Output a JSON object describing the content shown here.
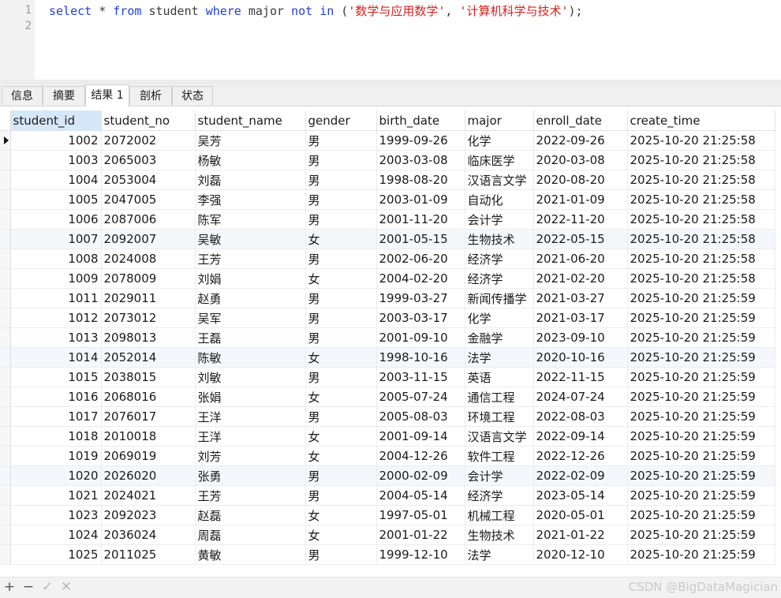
{
  "editor": {
    "line_numbers": [
      "1",
      "2"
    ],
    "sql": {
      "select": "select",
      "star": "*",
      "from": "from",
      "table": "student",
      "where": "where",
      "column": "major",
      "not": "not",
      "in": "in",
      "open": "(",
      "value1": "'数学与应用数学'",
      "comma": ",",
      "value2": "'计算机科学与技术'",
      "close": ");"
    }
  },
  "tabs": [
    {
      "label": "信息",
      "active": false
    },
    {
      "label": "摘要",
      "active": false
    },
    {
      "label": "结果 1",
      "active": true
    },
    {
      "label": "剖析",
      "active": false
    },
    {
      "label": "状态",
      "active": false
    }
  ],
  "grid": {
    "columns": [
      "student_id",
      "student_no",
      "student_name",
      "gender",
      "birth_date",
      "major",
      "enroll_date",
      "create_time"
    ],
    "rows": [
      [
        "1002",
        "2072002",
        "吴芳",
        "男",
        "1999-09-26",
        "化学",
        "2022-09-26",
        "2025-10-20 21:25:58"
      ],
      [
        "1003",
        "2065003",
        "杨敏",
        "男",
        "2003-03-08",
        "临床医学",
        "2020-03-08",
        "2025-10-20 21:25:58"
      ],
      [
        "1004",
        "2053004",
        "刘磊",
        "男",
        "1998-08-20",
        "汉语言文学",
        "2020-08-20",
        "2025-10-20 21:25:58"
      ],
      [
        "1005",
        "2047005",
        "李强",
        "男",
        "2003-01-09",
        "自动化",
        "2021-01-09",
        "2025-10-20 21:25:58"
      ],
      [
        "1006",
        "2087006",
        "陈军",
        "男",
        "2001-11-20",
        "会计学",
        "2022-11-20",
        "2025-10-20 21:25:58"
      ],
      [
        "1007",
        "2092007",
        "吴敏",
        "女",
        "2001-05-15",
        "生物技术",
        "2022-05-15",
        "2025-10-20 21:25:58"
      ],
      [
        "1008",
        "2024008",
        "王芳",
        "男",
        "2002-06-20",
        "经济学",
        "2021-06-20",
        "2025-10-20 21:25:58"
      ],
      [
        "1009",
        "2078009",
        "刘娟",
        "女",
        "2004-02-20",
        "经济学",
        "2021-02-20",
        "2025-10-20 21:25:58"
      ],
      [
        "1011",
        "2029011",
        "赵勇",
        "男",
        "1999-03-27",
        "新闻传播学",
        "2021-03-27",
        "2025-10-20 21:25:59"
      ],
      [
        "1012",
        "2073012",
        "吴军",
        "男",
        "2003-03-17",
        "化学",
        "2021-03-17",
        "2025-10-20 21:25:59"
      ],
      [
        "1013",
        "2098013",
        "王磊",
        "男",
        "2001-09-10",
        "金融学",
        "2023-09-10",
        "2025-10-20 21:25:59"
      ],
      [
        "1014",
        "2052014",
        "陈敏",
        "女",
        "1998-10-16",
        "法学",
        "2020-10-16",
        "2025-10-20 21:25:59"
      ],
      [
        "1015",
        "2038015",
        "刘敏",
        "男",
        "2003-11-15",
        "英语",
        "2022-11-15",
        "2025-10-20 21:25:59"
      ],
      [
        "1016",
        "2068016",
        "张娟",
        "女",
        "2005-07-24",
        "通信工程",
        "2024-07-24",
        "2025-10-20 21:25:59"
      ],
      [
        "1017",
        "2076017",
        "王洋",
        "男",
        "2005-08-03",
        "环境工程",
        "2022-08-03",
        "2025-10-20 21:25:59"
      ],
      [
        "1018",
        "2010018",
        "王洋",
        "女",
        "2001-09-14",
        "汉语言文学",
        "2022-09-14",
        "2025-10-20 21:25:59"
      ],
      [
        "1019",
        "2069019",
        "刘芳",
        "女",
        "2004-12-26",
        "软件工程",
        "2022-12-26",
        "2025-10-20 21:25:59"
      ],
      [
        "1020",
        "2026020",
        "张勇",
        "男",
        "2000-02-09",
        "会计学",
        "2022-02-09",
        "2025-10-20 21:25:59"
      ],
      [
        "1021",
        "2024021",
        "王芳",
        "男",
        "2004-05-14",
        "经济学",
        "2023-05-14",
        "2025-10-20 21:25:59"
      ],
      [
        "1023",
        "2092023",
        "赵磊",
        "女",
        "1997-05-01",
        "机械工程",
        "2020-05-01",
        "2025-10-20 21:25:59"
      ],
      [
        "1024",
        "2036024",
        "周磊",
        "女",
        "2001-01-22",
        "生物技术",
        "2021-01-22",
        "2025-10-20 21:25:59"
      ],
      [
        "1025",
        "2011025",
        "黄敏",
        "男",
        "1999-12-10",
        "法学",
        "2020-12-10",
        "2025-10-20 21:25:59"
      ]
    ]
  },
  "bottombar": {
    "add": "+",
    "remove": "−",
    "apply": "✓",
    "discard": "✕",
    "watermark": "CSDN @BigDataMagician"
  }
}
